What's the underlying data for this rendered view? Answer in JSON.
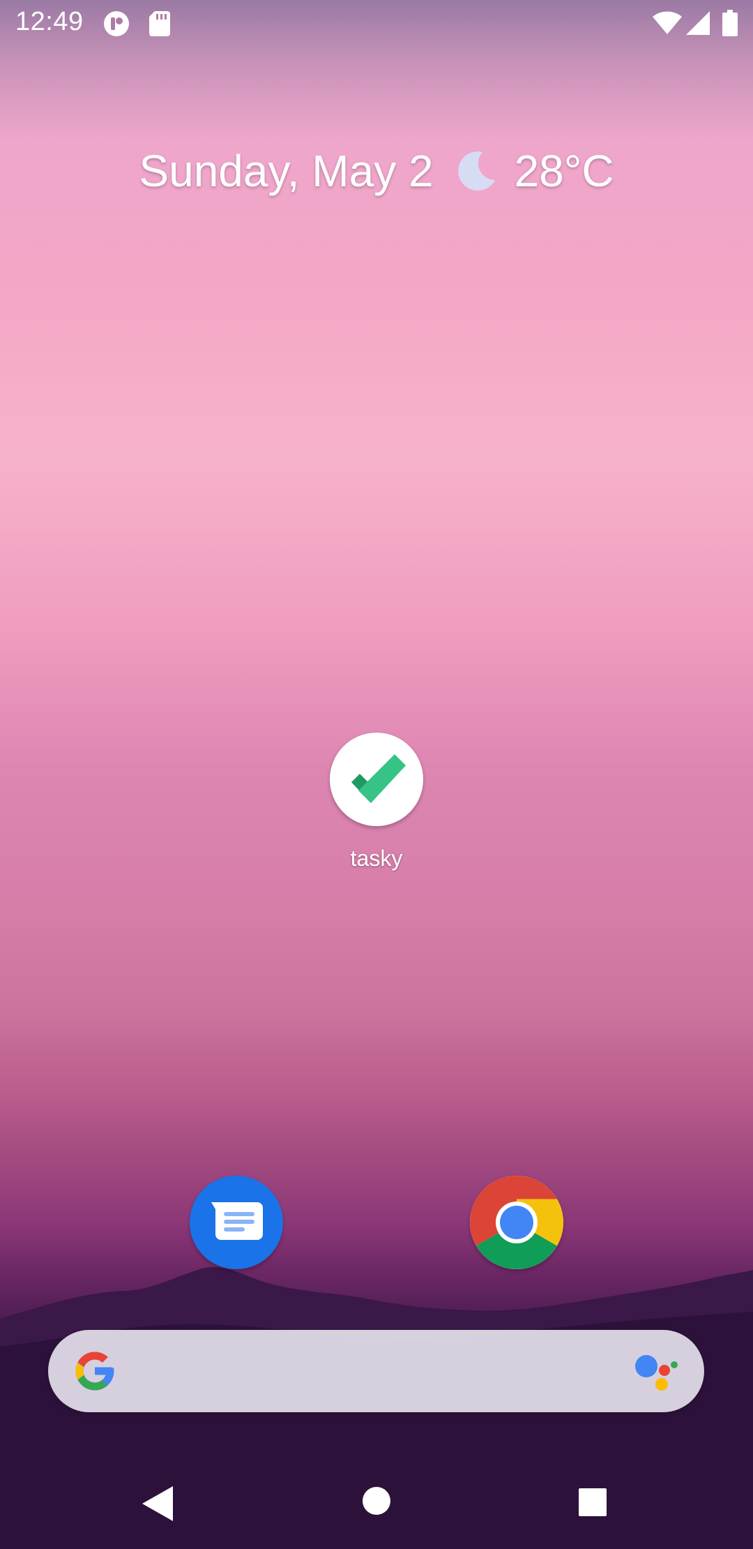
{
  "status_bar": {
    "time": "12:49",
    "left_icons": [
      "notification-app-icon",
      "sd-card-icon"
    ],
    "right_icons": [
      "wifi-icon",
      "cellular-signal-icon",
      "battery-icon"
    ]
  },
  "glance": {
    "date": "Sunday, May 2",
    "weather_icon": "moon-icon",
    "temperature": "28°C"
  },
  "home_apps": [
    {
      "label": "tasky",
      "icon": "checkmark-icon"
    }
  ],
  "dock": [
    {
      "icon": "messages-icon"
    },
    {
      "icon": "chrome-icon"
    }
  ],
  "search_bar": {
    "left_icon": "google-g-icon",
    "right_icon": "google-assistant-icon"
  },
  "nav_bar": {
    "buttons": [
      "back-icon",
      "home-icon",
      "recents-icon"
    ]
  },
  "colors": {
    "tasky_check": "#2fbf7a",
    "messages_blue": "#1a73e8",
    "chrome_red": "#db4437",
    "chrome_yellow": "#f4c20d",
    "chrome_green": "#0f9d58",
    "chrome_blue": "#4285f4"
  }
}
